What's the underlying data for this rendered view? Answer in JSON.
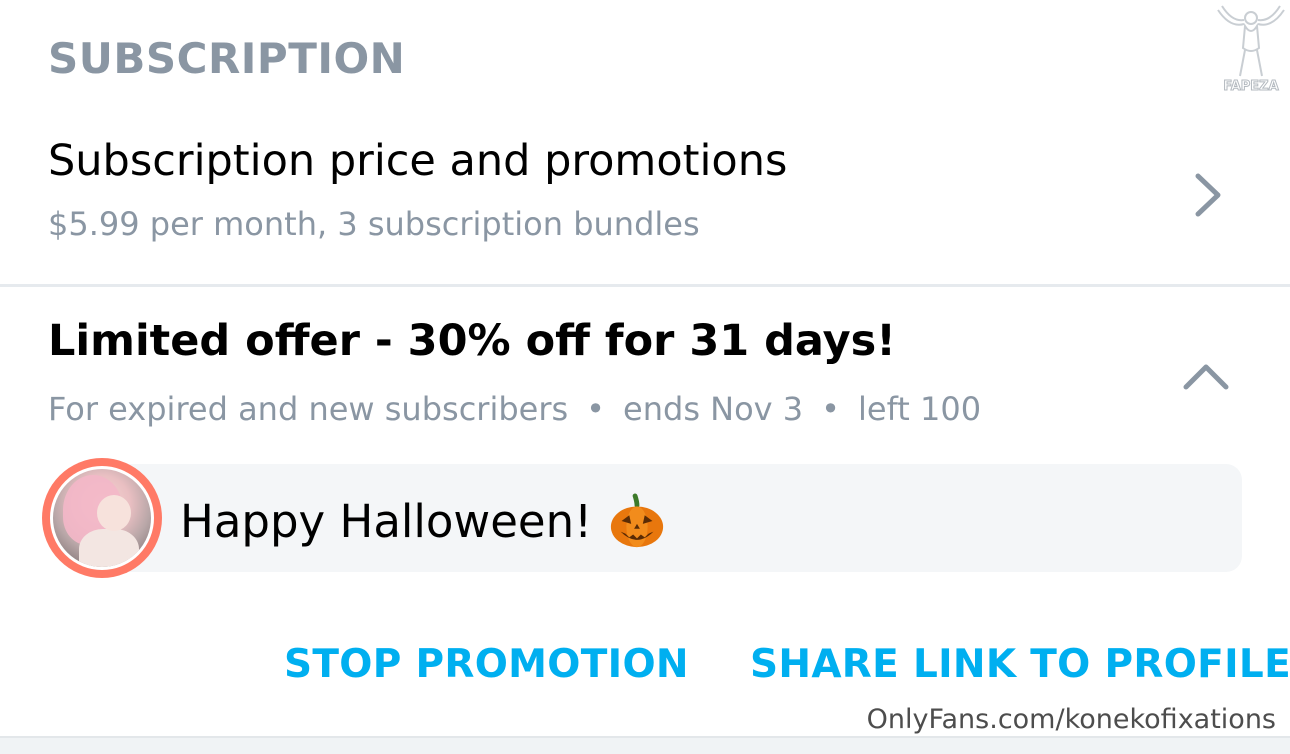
{
  "section": {
    "title": "SUBSCRIPTION"
  },
  "subscription_row": {
    "title": "Subscription price and promotions",
    "subtitle": "$5.99 per month, 3 subscription bundles"
  },
  "promotion": {
    "title": "Limited offer - 30% off for 31 days!",
    "audience": "For expired and new subscribers",
    "separator": "•",
    "ends": "ends Nov 3",
    "left": "left 100",
    "message": "Happy Halloween!"
  },
  "actions": {
    "stop_label": "STOP PROMOTION",
    "share_label": "SHARE LINK TO PROFILE"
  },
  "watermarks": {
    "logo_text": "FAPEZA",
    "url_text": "OnlyFans.com/konekofixations"
  },
  "icons": {
    "chevron_right": "chevron-right-icon",
    "chevron_up": "chevron-up-icon",
    "pumpkin": "jack-o-lantern-icon"
  },
  "colors": {
    "accent": "#00aff0",
    "muted_text": "#8a96a3",
    "avatar_ring": "#ff7a66",
    "bubble_bg": "#f4f6f8"
  }
}
